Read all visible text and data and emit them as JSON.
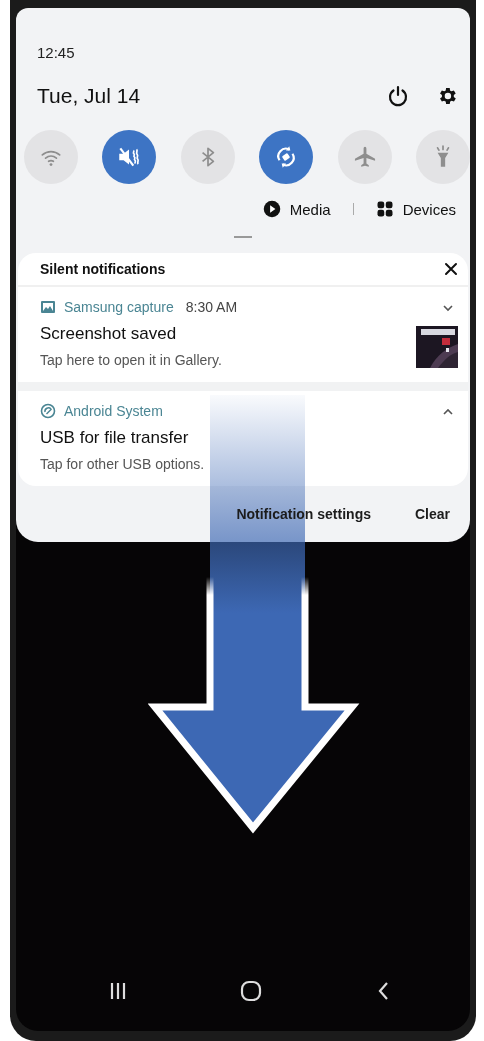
{
  "status": {
    "time": "12:45"
  },
  "header": {
    "date": "Tue, Jul 14"
  },
  "quick_tiles": [
    {
      "kind": "wifi",
      "on": false
    },
    {
      "kind": "sound",
      "on": true
    },
    {
      "kind": "bluetooth",
      "on": false
    },
    {
      "kind": "rotate",
      "on": true
    },
    {
      "kind": "airplane",
      "on": false
    },
    {
      "kind": "flashlight",
      "on": false
    }
  ],
  "media_row": {
    "media": "Media",
    "devices": "Devices"
  },
  "notification_group": {
    "title": "Silent notifications",
    "notifications": [
      {
        "kind": "gallery",
        "app": "Samsung capture",
        "time": "8:30 AM",
        "title": "Screenshot saved",
        "text": "Tap here to open it in Gallery.",
        "expanded": false
      },
      {
        "kind": "android",
        "app": "Android System",
        "title": "USB for file transfer",
        "text": "Tap for other USB options.",
        "expanded": true
      }
    ]
  },
  "footer": {
    "settings": "Notification settings",
    "clear": "Clear"
  }
}
